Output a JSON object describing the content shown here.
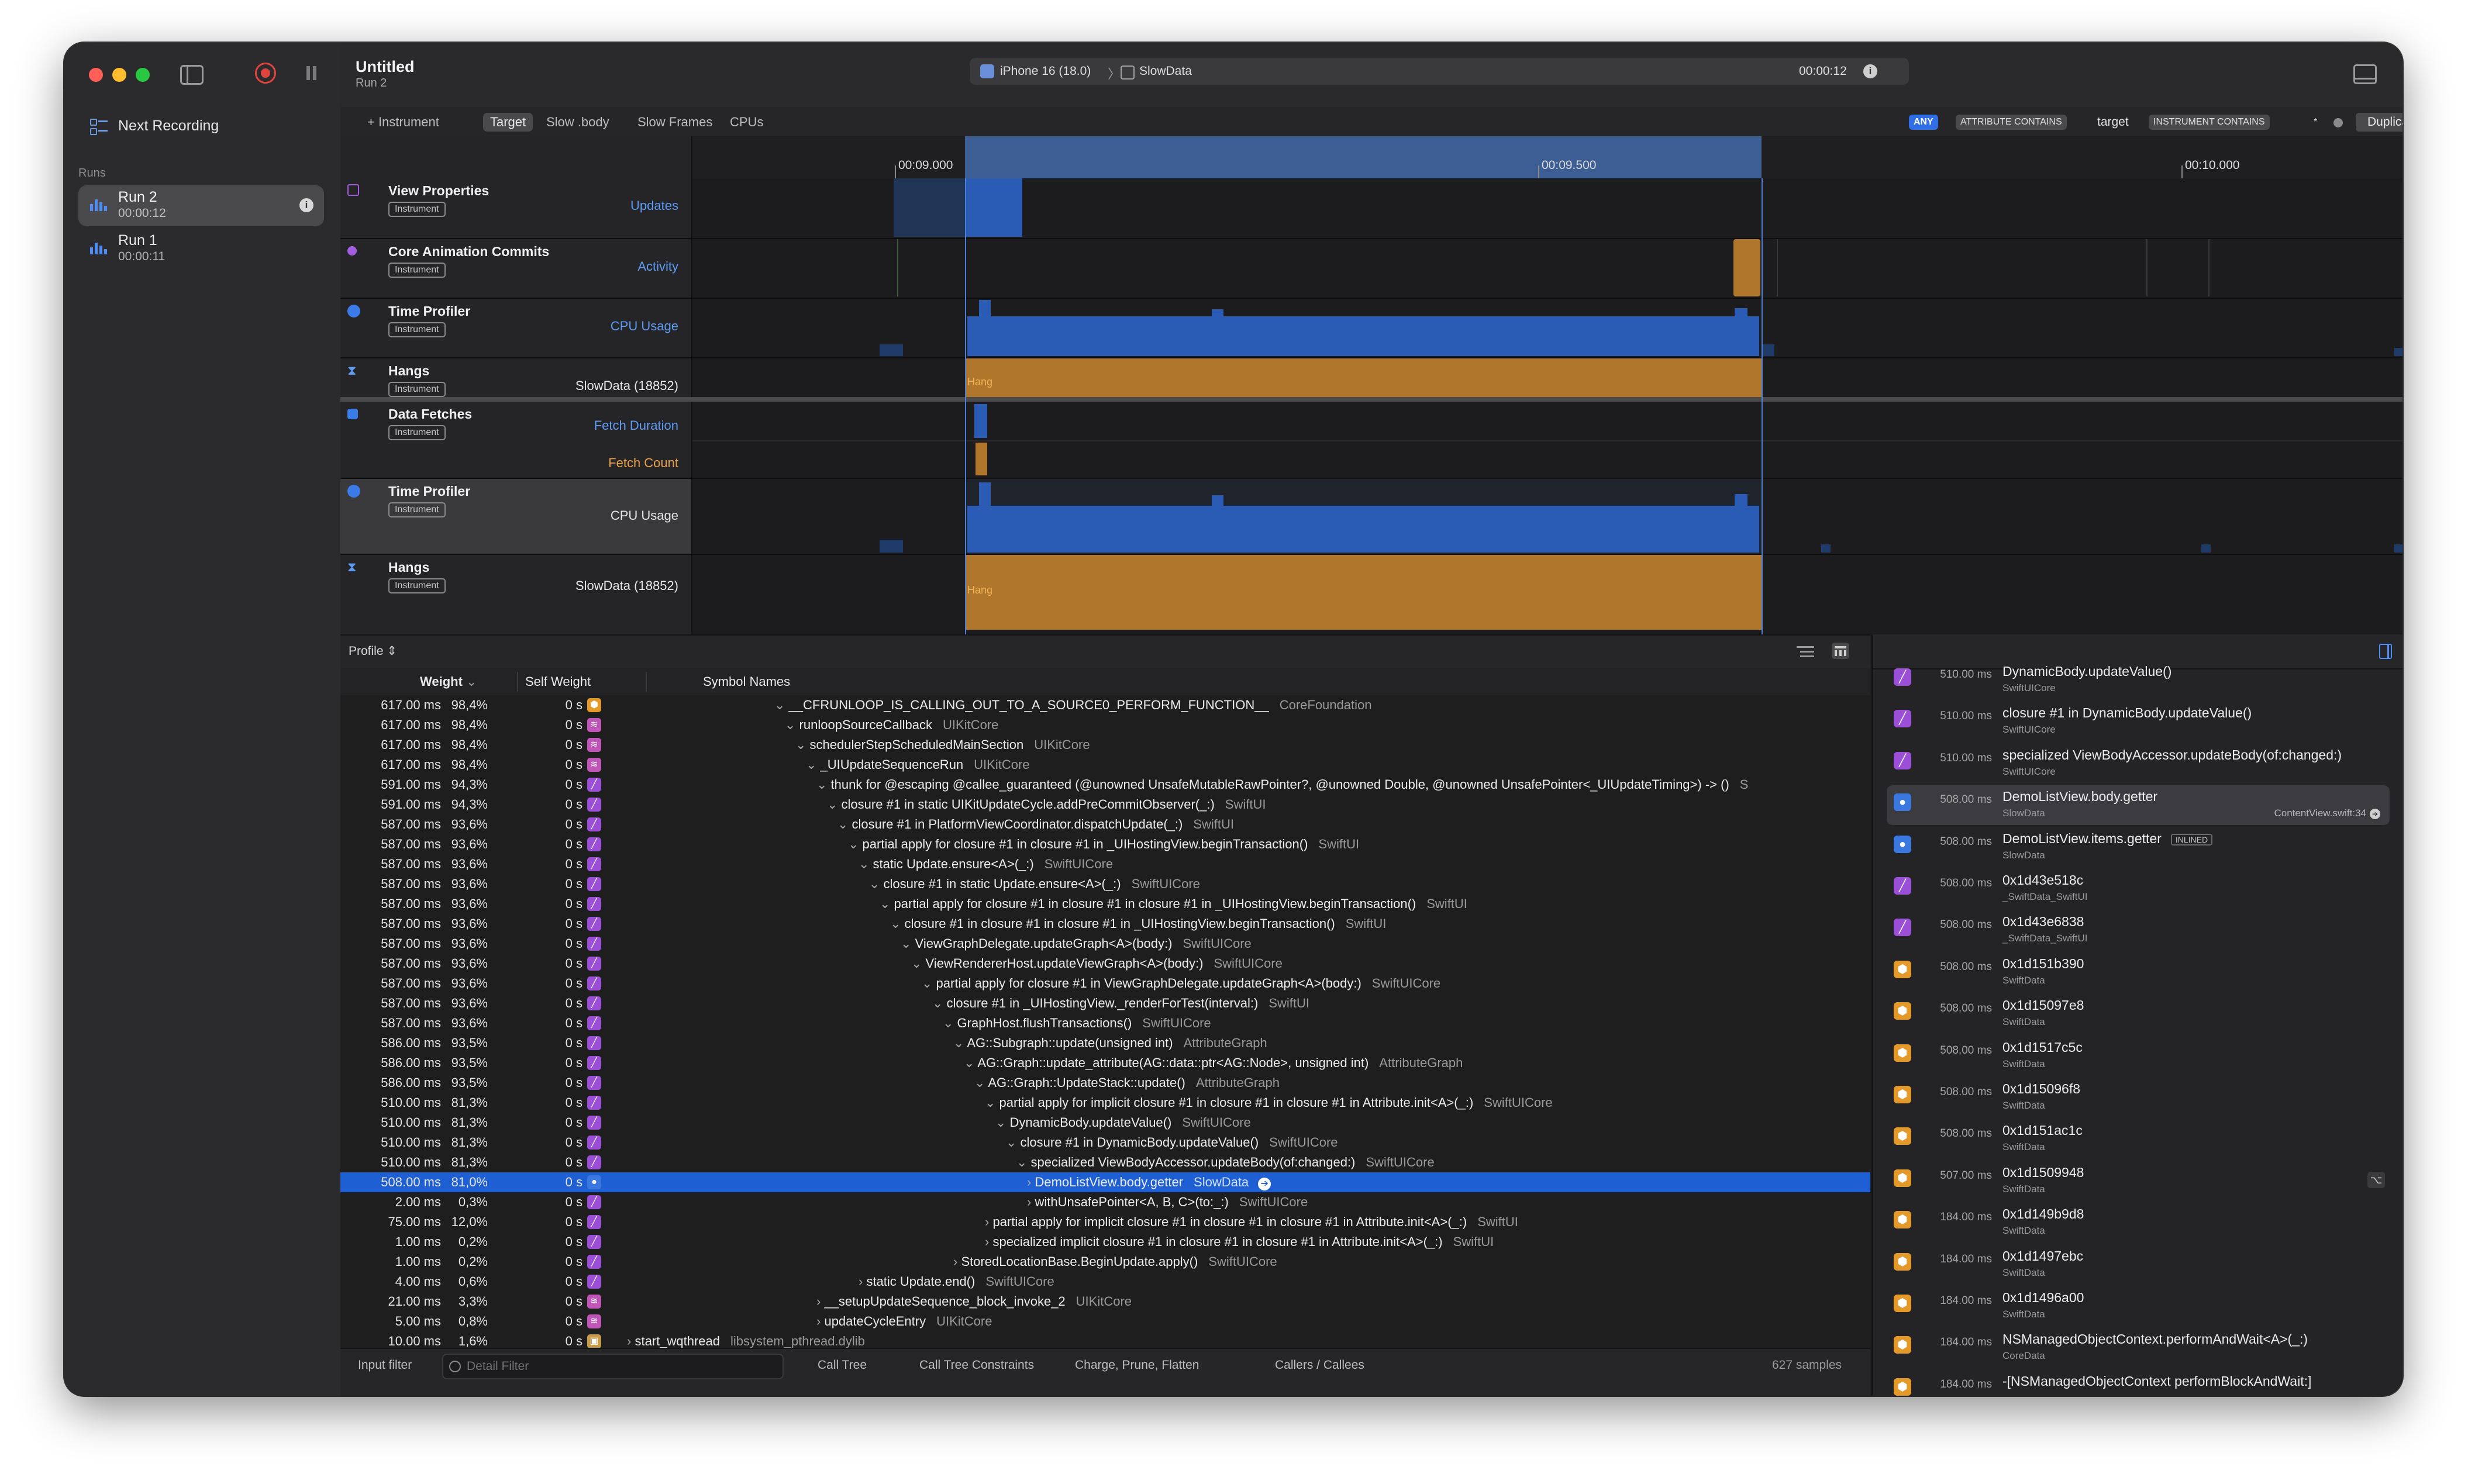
{
  "window": {
    "title": "Untitled",
    "subtitle": "Run 2",
    "device": "iPhone 16 (18.0)",
    "process": "SlowData",
    "elapsed": "00:00:12"
  },
  "sidebar": {
    "next_recording": "Next Recording",
    "runs_label": "Runs",
    "runs": [
      {
        "name": "Run 2",
        "time": "00:00:12"
      },
      {
        "name": "Run 1",
        "time": "00:00:11"
      }
    ]
  },
  "toolbar": {
    "add_instrument": "+ Instrument",
    "tabs": [
      "Target",
      "Slow .body",
      "Slow Frames",
      "CPUs"
    ],
    "filter_any": "ANY",
    "filter_attr": "ATTRIBUTE CONTAINS",
    "filter_value": "target",
    "filter_instr": "INSTRUMENT CONTAINS",
    "filter_star": "*",
    "duplicate": "Duplicate"
  },
  "timeline": {
    "ticks": [
      "00:09.000",
      "00:09.500",
      "00:10.000"
    ]
  },
  "tracks": [
    {
      "name": "View Properties",
      "badge": "Instrument",
      "lanes": [
        "Updates"
      ]
    },
    {
      "name": "Core Animation Commits",
      "badge": "Instrument",
      "lanes": [
        "Activity"
      ]
    },
    {
      "name": "Time Profiler",
      "badge": "Instrument",
      "lanes": [
        "CPU Usage"
      ]
    },
    {
      "name": "Hangs",
      "badge": "Instrument",
      "lanes": [
        "SlowData (18852)"
      ],
      "bar_label": "Hang"
    },
    {
      "name": "Data Fetches",
      "badge": "Instrument",
      "lanes": [
        "Fetch Duration",
        "Fetch Count"
      ]
    },
    {
      "name": "Time Profiler",
      "badge": "Instrument",
      "lanes": [
        "CPU Usage"
      ]
    },
    {
      "name": "Hangs",
      "badge": "Instrument",
      "lanes": [
        "SlowData (18852)"
      ],
      "bar_label": "Hang"
    }
  ],
  "profile": {
    "mode": "Profile",
    "columns": {
      "weight": "Weight",
      "self": "Self Weight",
      "symbol": "Symbol Names"
    },
    "rows": [
      {
        "w": "617.00 ms",
        "p": "98,4%",
        "s": "0 s",
        "i": "orange",
        "d": 0,
        "arrow": "⌄",
        "sym": "__CFRUNLOOP_IS_CALLING_OUT_TO_A_SOURCE0_PERFORM_FUNCTION__",
        "lib": "CoreFoundation"
      },
      {
        "w": "617.00 ms",
        "p": "98,4%",
        "s": "0 s",
        "i": "pink",
        "d": 1,
        "arrow": "⌄",
        "sym": "runloopSourceCallback",
        "lib": "UIKitCore"
      },
      {
        "w": "617.00 ms",
        "p": "98,4%",
        "s": "0 s",
        "i": "pink",
        "d": 2,
        "arrow": "⌄",
        "sym": "schedulerStepScheduledMainSection",
        "lib": "UIKitCore"
      },
      {
        "w": "617.00 ms",
        "p": "98,4%",
        "s": "0 s",
        "i": "pink",
        "d": 3,
        "arrow": "⌄",
        "sym": "_UIUpdateSequenceRun",
        "lib": "UIKitCore"
      },
      {
        "w": "591.00 ms",
        "p": "94,3%",
        "s": "0 s",
        "i": "purple",
        "d": 4,
        "arrow": "⌄",
        "sym": "thunk for @escaping @callee_guaranteed (@unowned UnsafeMutableRawPointer?, @unowned Double, @unowned UnsafePointer<_UIUpdateTiming>) -> ()",
        "lib": "S"
      },
      {
        "w": "591.00 ms",
        "p": "94,3%",
        "s": "0 s",
        "i": "purple",
        "d": 5,
        "arrow": "⌄",
        "sym": "closure #1 in static UIKitUpdateCycle.addPreCommitObserver(_:)",
        "lib": "SwiftUI"
      },
      {
        "w": "587.00 ms",
        "p": "93,6%",
        "s": "0 s",
        "i": "purple",
        "d": 6,
        "arrow": "⌄",
        "sym": "closure #1 in PlatformViewCoordinator.dispatchUpdate(_:)",
        "lib": "SwiftUI"
      },
      {
        "w": "587.00 ms",
        "p": "93,6%",
        "s": "0 s",
        "i": "purple",
        "d": 7,
        "arrow": "⌄",
        "sym": "partial apply for closure #1 in closure #1 in _UIHostingView.beginTransaction()",
        "lib": "SwiftUI"
      },
      {
        "w": "587.00 ms",
        "p": "93,6%",
        "s": "0 s",
        "i": "purple",
        "d": 8,
        "arrow": "⌄",
        "sym": "static Update.ensure<A>(_:)",
        "lib": "SwiftUICore"
      },
      {
        "w": "587.00 ms",
        "p": "93,6%",
        "s": "0 s",
        "i": "purple",
        "d": 9,
        "arrow": "⌄",
        "sym": "closure #1 in static Update.ensure<A>(_:)",
        "lib": "SwiftUICore"
      },
      {
        "w": "587.00 ms",
        "p": "93,6%",
        "s": "0 s",
        "i": "purple",
        "d": 10,
        "arrow": "⌄",
        "sym": "partial apply for closure #1 in closure #1 in closure #1 in _UIHostingView.beginTransaction()",
        "lib": "SwiftUI"
      },
      {
        "w": "587.00 ms",
        "p": "93,6%",
        "s": "0 s",
        "i": "purple",
        "d": 11,
        "arrow": "⌄",
        "sym": "closure #1 in closure #1 in closure #1 in _UIHostingView.beginTransaction()",
        "lib": "SwiftUI"
      },
      {
        "w": "587.00 ms",
        "p": "93,6%",
        "s": "0 s",
        "i": "purple",
        "d": 12,
        "arrow": "⌄",
        "sym": "ViewGraphDelegate.updateGraph<A>(body:)",
        "lib": "SwiftUICore"
      },
      {
        "w": "587.00 ms",
        "p": "93,6%",
        "s": "0 s",
        "i": "purple",
        "d": 13,
        "arrow": "⌄",
        "sym": "ViewRendererHost.updateViewGraph<A>(body:)",
        "lib": "SwiftUICore"
      },
      {
        "w": "587.00 ms",
        "p": "93,6%",
        "s": "0 s",
        "i": "purple",
        "d": 14,
        "arrow": "⌄",
        "sym": "partial apply for closure #1 in ViewGraphDelegate.updateGraph<A>(body:)",
        "lib": "SwiftUICore"
      },
      {
        "w": "587.00 ms",
        "p": "93,6%",
        "s": "0 s",
        "i": "purple",
        "d": 15,
        "arrow": "⌄",
        "sym": "closure #1 in _UIHostingView._renderForTest(interval:)",
        "lib": "SwiftUI"
      },
      {
        "w": "587.00 ms",
        "p": "93,6%",
        "s": "0 s",
        "i": "purple",
        "d": 16,
        "arrow": "⌄",
        "sym": "GraphHost.flushTransactions()",
        "lib": "SwiftUICore"
      },
      {
        "w": "586.00 ms",
        "p": "93,5%",
        "s": "0 s",
        "i": "purple",
        "d": 17,
        "arrow": "⌄",
        "sym": "AG::Subgraph::update(unsigned int)",
        "lib": "AttributeGraph"
      },
      {
        "w": "586.00 ms",
        "p": "93,5%",
        "s": "0 s",
        "i": "purple",
        "d": 18,
        "arrow": "⌄",
        "sym": "AG::Graph::update_attribute(AG::data::ptr<AG::Node>, unsigned int)",
        "lib": "AttributeGraph"
      },
      {
        "w": "586.00 ms",
        "p": "93,5%",
        "s": "0 s",
        "i": "purple",
        "d": 19,
        "arrow": "⌄",
        "sym": "AG::Graph::UpdateStack::update()",
        "lib": "AttributeGraph"
      },
      {
        "w": "510.00 ms",
        "p": "81,3%",
        "s": "0 s",
        "i": "purple",
        "d": 20,
        "arrow": "⌄",
        "sym": "partial apply for implicit closure #1 in closure #1 in closure #1 in Attribute.init<A>(_:)",
        "lib": "SwiftUICore"
      },
      {
        "w": "510.00 ms",
        "p": "81,3%",
        "s": "0 s",
        "i": "purple",
        "d": 21,
        "arrow": "⌄",
        "sym": "DynamicBody.updateValue()",
        "lib": "SwiftUICore"
      },
      {
        "w": "510.00 ms",
        "p": "81,3%",
        "s": "0 s",
        "i": "purple",
        "d": 22,
        "arrow": "⌄",
        "sym": "closure #1 in DynamicBody.updateValue()",
        "lib": "SwiftUICore"
      },
      {
        "w": "510.00 ms",
        "p": "81,3%",
        "s": "0 s",
        "i": "purple",
        "d": 23,
        "arrow": "⌄",
        "sym": "specialized ViewBodyAccessor.updateBody(of:changed:)",
        "lib": "SwiftUICore"
      },
      {
        "w": "508.00 ms",
        "p": "81,0%",
        "s": "0 s",
        "i": "user",
        "d": 24,
        "arrow": "›",
        "sym": "DemoListView.body.getter",
        "lib": "SlowData",
        "sel": true
      },
      {
        "w": "2.00 ms",
        "p": "0,3%",
        "s": "0 s",
        "i": "purple",
        "d": 24,
        "arrow": "›",
        "sym": "withUnsafePointer<A, B, C>(to:_:)",
        "lib": "SwiftUICore"
      },
      {
        "w": "75.00 ms",
        "p": "12,0%",
        "s": "0 s",
        "i": "purple",
        "d": 20,
        "arrow": "›",
        "sym": "partial apply for implicit closure #1 in closure #1 in closure #1 in Attribute.init<A>(_:)",
        "lib": "SwiftUI"
      },
      {
        "w": "1.00 ms",
        "p": "0,2%",
        "s": "0 s",
        "i": "purple",
        "d": 20,
        "arrow": "›",
        "sym": "specialized implicit closure #1 in closure #1 in closure #1 in Attribute.init<A>(_:)",
        "lib": "SwiftUI"
      },
      {
        "w": "1.00 ms",
        "p": "0,2%",
        "s": "0 s",
        "i": "purple",
        "d": 17,
        "arrow": "›",
        "sym": "StoredLocationBase.BeginUpdate.apply()",
        "lib": "SwiftUICore"
      },
      {
        "w": "4.00 ms",
        "p": "0,6%",
        "s": "0 s",
        "i": "purple",
        "d": 8,
        "arrow": "›",
        "sym": "static Update.end()",
        "lib": "SwiftUICore"
      },
      {
        "w": "21.00 ms",
        "p": "3,3%",
        "s": "0 s",
        "i": "pink",
        "d": 4,
        "arrow": "›",
        "sym": "__setupUpdateSequence_block_invoke_2",
        "lib": "UIKitCore"
      },
      {
        "w": "5.00 ms",
        "p": "0,8%",
        "s": "0 s",
        "i": "pink",
        "d": 4,
        "arrow": "›",
        "sym": "updateCycleEntry",
        "lib": "UIKitCore"
      },
      {
        "w": "10.00 ms",
        "p": "1,6%",
        "s": "0 s",
        "i": "tan",
        "d": -14,
        "arrow": "›",
        "sym": "start_wqthread",
        "lib": "libsystem_pthread.dylib"
      }
    ]
  },
  "status": {
    "input_filter": "Input filter",
    "detail_placeholder": "Detail Filter",
    "modes": [
      "Call Tree",
      "Call Tree Constraints",
      "Charge, Prune, Flatten",
      "Callers / Callees"
    ],
    "samples": "627 samples"
  },
  "stack": [
    {
      "ms": "510.00 ms",
      "sym": "DynamicBody.updateValue()",
      "lib": "SwiftUICore",
      "i": "purple"
    },
    {
      "ms": "510.00 ms",
      "sym": "closure #1 in DynamicBody.updateValue()",
      "lib": "SwiftUICore",
      "i": "purple"
    },
    {
      "ms": "510.00 ms",
      "sym": "specialized ViewBodyAccessor.updateBody(of:changed:)",
      "lib": "SwiftUICore",
      "i": "purple"
    },
    {
      "ms": "508.00 ms",
      "sym": "DemoListView.body.getter",
      "lib": "SlowData",
      "i": "user",
      "sel": true,
      "src": "ContentView.swift:34"
    },
    {
      "ms": "508.00 ms",
      "sym": "DemoListView.items.getter",
      "lib": "SlowData",
      "i": "user",
      "tag": "INLINED"
    },
    {
      "ms": "508.00 ms",
      "sym": "0x1d43e518c",
      "lib": "_SwiftData_SwiftUI",
      "i": "purple"
    },
    {
      "ms": "508.00 ms",
      "sym": "0x1d43e6838",
      "lib": "_SwiftData_SwiftUI",
      "i": "purple"
    },
    {
      "ms": "508.00 ms",
      "sym": "0x1d151b390",
      "lib": "SwiftData",
      "i": "orange"
    },
    {
      "ms": "508.00 ms",
      "sym": "0x1d15097e8",
      "lib": "SwiftData",
      "i": "orange"
    },
    {
      "ms": "508.00 ms",
      "sym": "0x1d1517c5c",
      "lib": "SwiftData",
      "i": "orange"
    },
    {
      "ms": "508.00 ms",
      "sym": "0x1d15096f8",
      "lib": "SwiftData",
      "i": "orange"
    },
    {
      "ms": "508.00 ms",
      "sym": "0x1d151ac1c",
      "lib": "SwiftData",
      "i": "orange"
    },
    {
      "ms": "507.00 ms",
      "sym": "0x1d1509948",
      "lib": "SwiftData",
      "i": "orange"
    },
    {
      "ms": "184.00 ms",
      "sym": "0x1d149b9d8",
      "lib": "SwiftData",
      "i": "orange"
    },
    {
      "ms": "184.00 ms",
      "sym": "0x1d1497ebc",
      "lib": "SwiftData",
      "i": "orange"
    },
    {
      "ms": "184.00 ms",
      "sym": "0x1d1496a00",
      "lib": "SwiftData",
      "i": "orange"
    },
    {
      "ms": "184.00 ms",
      "sym": "NSManagedObjectContext.performAndWait<A>(_:)",
      "lib": "CoreData",
      "i": "orange"
    },
    {
      "ms": "184.00 ms",
      "sym": "-[NSManagedObjectContext performBlockAndWait:]",
      "lib": "",
      "i": "orange"
    }
  ],
  "colors": {
    "accent": "#1f5fd4",
    "cpu": "#2a5bb5",
    "hang": "#b0772c",
    "record": "#e0443e"
  }
}
